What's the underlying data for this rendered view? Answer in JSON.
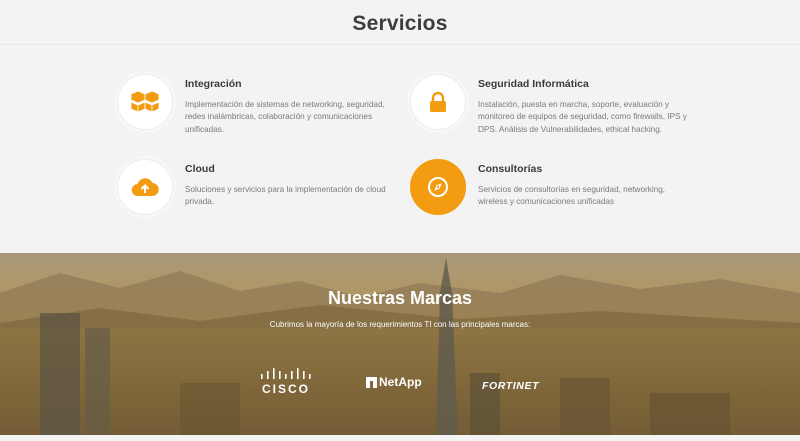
{
  "servicios": {
    "title": "Servicios",
    "items": [
      {
        "title": "Integración",
        "icon": "boxes-icon",
        "description": "Implementación de sistemas de networking, seguridad, redes inalámbricas, colaboración y comunicaciones unificadas."
      },
      {
        "title": "Seguridad Informática",
        "icon": "lock-icon",
        "description": "Instalación, puesta en marcha, soporte, evaluación y monitoreo de equipos de seguridad, como firewalls, IPS y DPS. Análisis de Vulnerabilidades, ethical hacking."
      },
      {
        "title": "Cloud",
        "icon": "cloud-upload-icon",
        "description": "Soluciones y servicios para la implementación de cloud privada."
      },
      {
        "title": "Consultorías",
        "icon": "compass-icon",
        "description": "Servicios de consultorías en seguridad, networking, wireless y comunicaciones unificadas"
      }
    ]
  },
  "marcas": {
    "title": "Nuestras Marcas",
    "subtitle": "Cubrimos la mayoría de los requerimientos TI con las principales marcas:",
    "brands": [
      "CISCO",
      "NetApp",
      "FORTINET"
    ]
  },
  "colors": {
    "accent": "#f39c12",
    "background": "#f3f3f3",
    "text": "#3a3a3a",
    "muted": "#7a7a7a"
  }
}
